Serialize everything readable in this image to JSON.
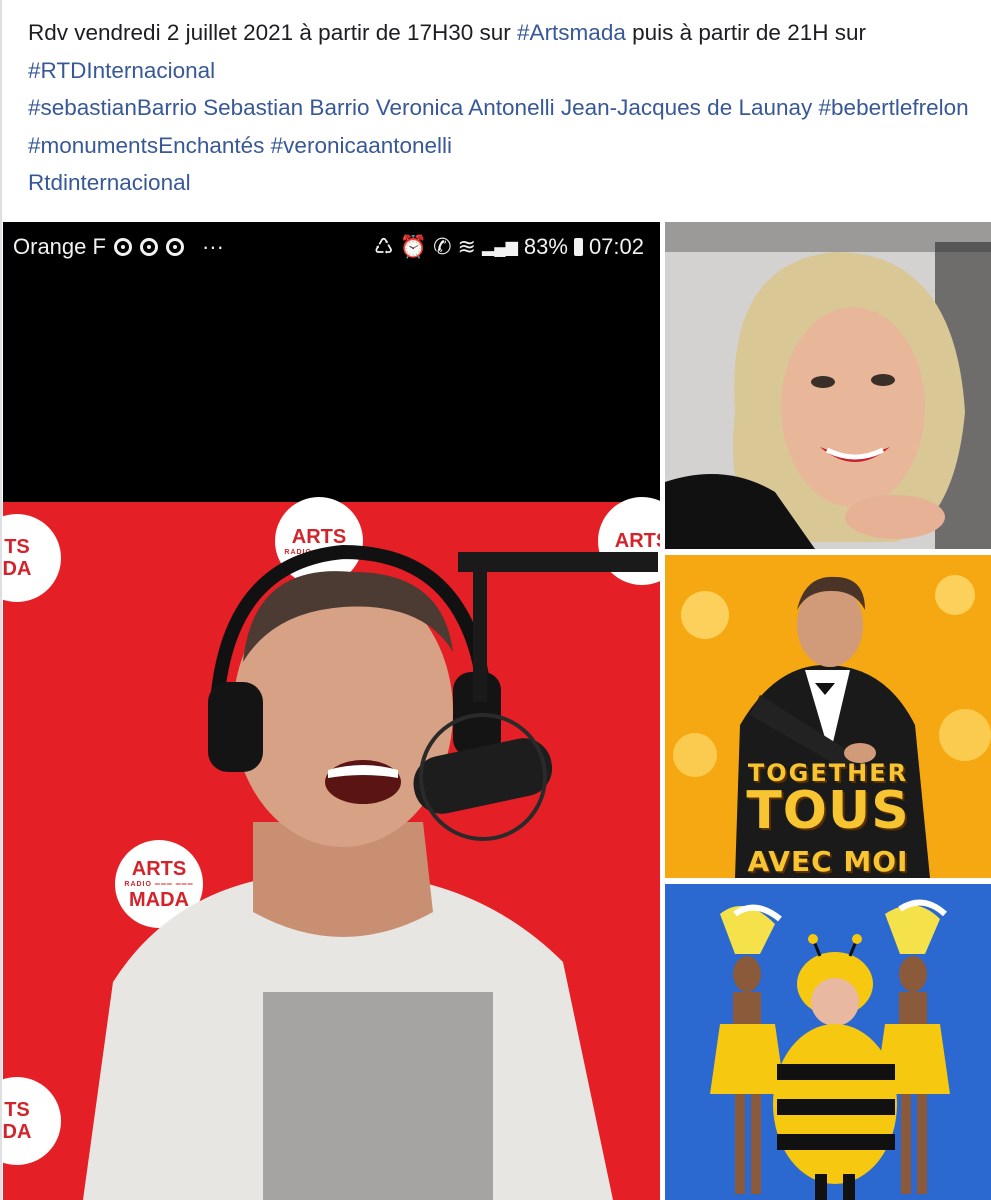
{
  "post": {
    "text_1": "Rdv vendredi 2 juillet 2021 à partir de 17H30 sur ",
    "link_artsmada": "#Artsmada",
    "text_2": " puis à partir de 21H sur ",
    "link_rtd": "#RTDInternacional",
    "tag_sebastian": "#sebastianBarrio",
    "tag_names": " Sebastian Barrio Veronica Antonelli Jean-Jacques de Launay ",
    "tag_bebert": "#bebertlefrelon",
    "tag_monuments": "#monumentsEnchantés",
    "tag_veronica": "#veronicaantonelli",
    "tag_rtd_plain": "Rtdinternacional"
  },
  "status_bar": {
    "carrier": "Orange F",
    "dots": "···",
    "battery": "83%",
    "time": "07:02"
  },
  "logos": {
    "arts": "ARTS",
    "mada": "MADA",
    "mid": "RADIO ═══ ═══",
    "left_partial_top": "TS",
    "left_partial_bottom": "DA"
  },
  "show": {
    "together": "TOGETHER",
    "tous": "TOUS",
    "avec_moi": "AVEC MOI"
  },
  "colors": {
    "link": "#385898",
    "wall_red": "#e51f26",
    "show_yellow": "#f6b417",
    "stage_blue": "#2a67cc"
  }
}
